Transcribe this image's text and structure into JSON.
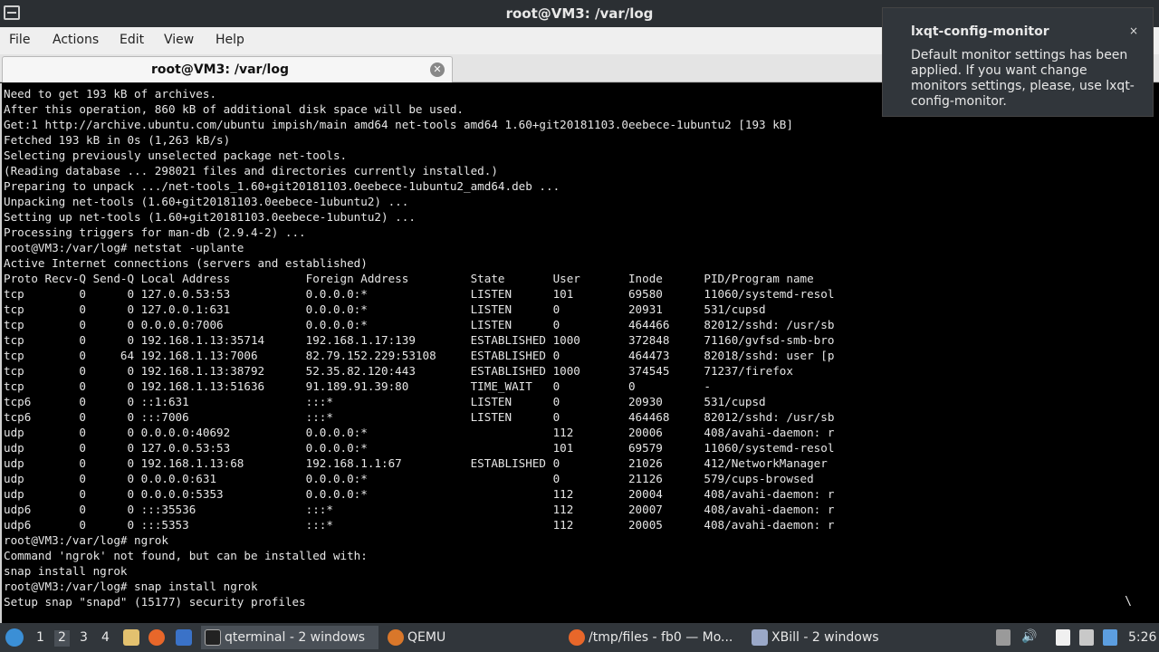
{
  "window": {
    "title": "root@VM3: /var/log"
  },
  "menu": [
    "File",
    "Actions",
    "Edit",
    "View",
    "Help"
  ],
  "tab": {
    "label": "root@VM3: /var/log"
  },
  "terminal": {
    "lines": [
      "Need to get 193 kB of archives.",
      "After this operation, 860 kB of additional disk space will be used.",
      "Get:1 http://archive.ubuntu.com/ubuntu impish/main amd64 net-tools amd64 1.60+git20181103.0eebece-1ubuntu2 [193 kB]",
      "Fetched 193 kB in 0s (1,263 kB/s)",
      "Selecting previously unselected package net-tools.",
      "(Reading database ... 298021 files and directories currently installed.)",
      "Preparing to unpack .../net-tools_1.60+git20181103.0eebece-1ubuntu2_amd64.deb ...",
      "Unpacking net-tools (1.60+git20181103.0eebece-1ubuntu2) ...",
      "Setting up net-tools (1.60+git20181103.0eebece-1ubuntu2) ...",
      "Processing triggers for man-db (2.9.4-2) ...",
      "root@VM3:/var/log# netstat -uplante",
      "Active Internet connections (servers and established)",
      "Proto Recv-Q Send-Q Local Address           Foreign Address         State       User       Inode      PID/Program name",
      "tcp        0      0 127.0.0.53:53           0.0.0.0:*               LISTEN      101        69580      11060/systemd-resol",
      "tcp        0      0 127.0.0.1:631           0.0.0.0:*               LISTEN      0          20931      531/cupsd",
      "tcp        0      0 0.0.0.0:7006            0.0.0.0:*               LISTEN      0          464466     82012/sshd: /usr/sb",
      "tcp        0      0 192.168.1.13:35714      192.168.1.17:139        ESTABLISHED 1000       372848     71160/gvfsd-smb-bro",
      "tcp        0     64 192.168.1.13:7006       82.79.152.229:53108     ESTABLISHED 0          464473     82018/sshd: user [p",
      "tcp        0      0 192.168.1.13:38792      52.35.82.120:443        ESTABLISHED 1000       374545     71237/firefox",
      "tcp        0      0 192.168.1.13:51636      91.189.91.39:80         TIME_WAIT   0          0          -",
      "tcp6       0      0 ::1:631                 :::*                    LISTEN      0          20930      531/cupsd",
      "tcp6       0      0 :::7006                 :::*                    LISTEN      0          464468     82012/sshd: /usr/sb",
      "udp        0      0 0.0.0.0:40692           0.0.0.0:*                           112        20006      408/avahi-daemon: r",
      "udp        0      0 127.0.0.53:53           0.0.0.0:*                           101        69579      11060/systemd-resol",
      "udp        0      0 192.168.1.13:68         192.168.1.1:67          ESTABLISHED 0          21026      412/NetworkManager",
      "udp        0      0 0.0.0.0:631             0.0.0.0:*                           0          21126      579/cups-browsed",
      "udp        0      0 0.0.0.0:5353            0.0.0.0:*                           112        20004      408/avahi-daemon: r",
      "udp6       0      0 :::35536                :::*                                112        20007      408/avahi-daemon: r",
      "udp6       0      0 :::5353                 :::*                                112        20005      408/avahi-daemon: r",
      "root@VM3:/var/log# ngrok",
      "Command 'ngrok' not found, but can be installed with:",
      "snap install ngrok",
      "root@VM3:/var/log# snap install ngrok",
      "Setup snap \"snapd\" (15177) security profiles"
    ],
    "spinner": "\\"
  },
  "notification": {
    "title": "lxqt-config-monitor",
    "close": "×",
    "body": "Default monitor settings has been applied. If you want change monitors settings, please, use lxqt-config-monitor."
  },
  "taskbar": {
    "desktops": [
      "1",
      "2",
      "3",
      "4"
    ],
    "active_desktop": "2",
    "tasks": [
      {
        "label": "qterminal - 2 windows",
        "icon": "terminal-icon"
      },
      {
        "label": "QEMU",
        "icon": "qemu-icon"
      },
      {
        "label": "/tmp/files - fb0 — Mo...",
        "icon": "firefox-icon"
      },
      {
        "label": "XBill - 2 windows",
        "icon": "xbill-icon"
      }
    ],
    "clock": "5:26"
  }
}
